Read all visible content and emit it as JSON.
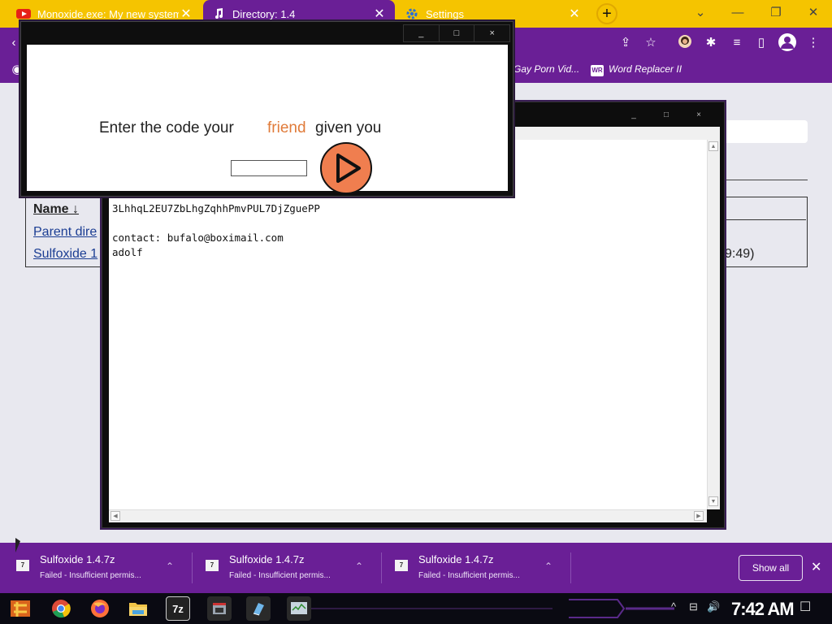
{
  "browser": {
    "tabs": [
      {
        "title": "Monoxide.exe: My new system",
        "icon": "youtube-icon"
      },
      {
        "title": "Directory: 1.4",
        "icon": "music-note-icon"
      },
      {
        "title": "Settings",
        "icon": "gear-icon"
      }
    ],
    "new_tab_glyph": "+",
    "window_controls": {
      "chevron": "⌄",
      "minimize": "—",
      "restore": "❐",
      "close": "✕"
    },
    "toolbar": {
      "share": "⇪",
      "star": "☆",
      "extensions": "✱",
      "media": "≡",
      "sidepanel": "▯",
      "menu": "⋮",
      "back": "‹",
      "globe": "◉"
    },
    "bookmarks": [
      {
        "label": "Gay Porn Vid...",
        "icon_text": "",
        "icon": "bookmark-icon"
      },
      {
        "label": "Word Replacer II",
        "icon_text": "WR",
        "icon": "word-replacer-icon"
      }
    ]
  },
  "directory": {
    "name_header": "Name ↓",
    "rows": [
      {
        "label": "Parent dire"
      },
      {
        "label": "Sulfoxide 1"
      }
    ],
    "partial_time": "9:49)"
  },
  "notepad": {
    "lines": [
      "3LhhqL2EU7ZbLhgZqhhPmvPUL7DjZguePP",
      "",
      "contact: bufalo@boximail.com",
      "adolf"
    ],
    "buttons": {
      "minimize": "_",
      "maximize": "□",
      "close": "×"
    }
  },
  "dialog": {
    "prompt_part1": "Enter the code your",
    "prompt_accent": "friend",
    "prompt_part2": "given you",
    "accent_color": "#e07b3a",
    "input_value": "",
    "buttons": {
      "minimize": "_",
      "maximize": "□",
      "close": "×"
    }
  },
  "downloads": {
    "items": [
      {
        "name": "Sulfoxide 1.4.7z",
        "status": "Failed - Insufficient permis...",
        "icon_text": "7"
      },
      {
        "name": "Sulfoxide 1.4.7z",
        "status": "Failed - Insufficient permis...",
        "icon_text": "7"
      },
      {
        "name": "Sulfoxide 1.4.7z",
        "status": "Failed - Insufficient permis...",
        "icon_text": "7"
      }
    ],
    "chevron": "⌃",
    "show_all": "Show all",
    "close": "✕"
  },
  "taskbar": {
    "time": "7:42 AM",
    "apps": [
      {
        "icon": "start-icon"
      },
      {
        "icon": "chrome-icon"
      },
      {
        "icon": "firefox-icon"
      },
      {
        "icon": "folder-icon"
      },
      {
        "icon": "7zip-icon",
        "label": "7z"
      },
      {
        "icon": "app-window-icon"
      },
      {
        "icon": "notepad-icon"
      },
      {
        "icon": "task-manager-icon"
      }
    ],
    "tray": {
      "chevron": "^",
      "network": "⊟",
      "volume": "🔊",
      "notifications": "☐"
    }
  },
  "colors": {
    "tab_strip": "#f5c400",
    "browser_purple": "#6a1f96",
    "page_bg": "#e8e8ef",
    "play_button": "#f07e4f",
    "link": "#1b3d93"
  }
}
